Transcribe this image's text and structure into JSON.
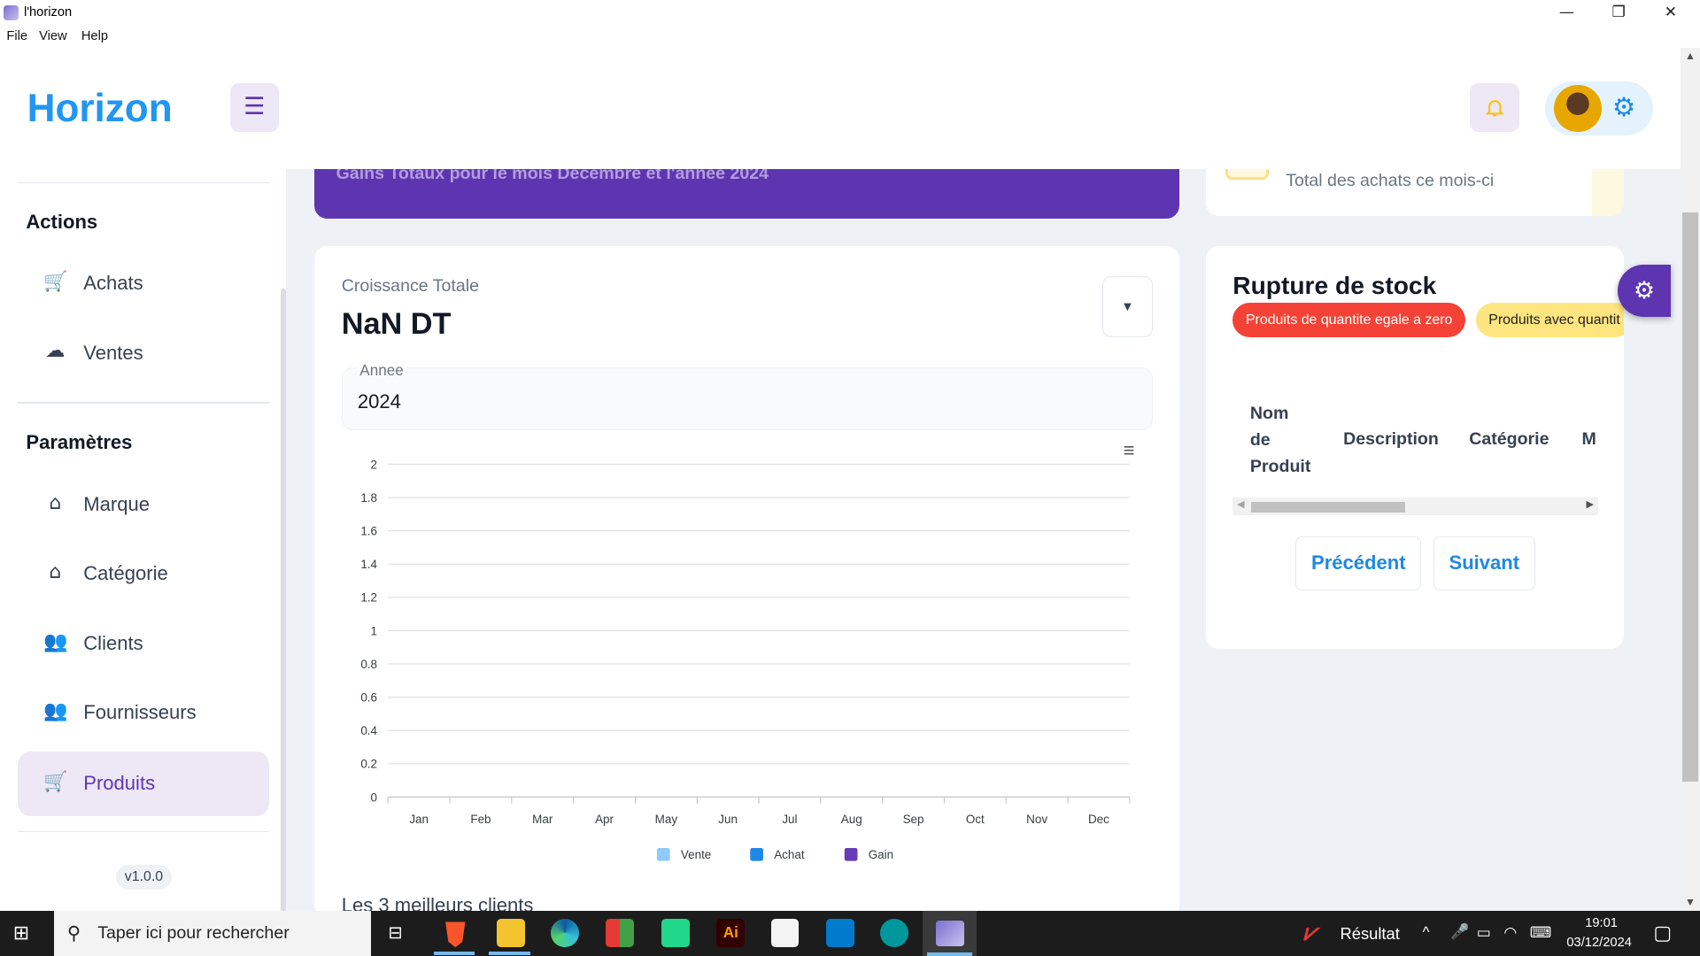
{
  "window": {
    "title": "l'horizon",
    "menu": [
      "File",
      "View",
      "Help"
    ],
    "controls": [
      "—",
      "❐",
      "✕"
    ]
  },
  "header": {
    "logo": "Horizon"
  },
  "sidebar": {
    "sections": [
      {
        "title": "Actions",
        "items": [
          {
            "label": "Achats",
            "icon": "cart-icon"
          },
          {
            "label": "Ventes",
            "icon": "sales-icon"
          }
        ]
      },
      {
        "title": "Paramètres",
        "items": [
          {
            "label": "Marque",
            "icon": "tag-icon"
          },
          {
            "label": "Catégorie",
            "icon": "tag-icon"
          },
          {
            "label": "Clients",
            "icon": "users-icon"
          },
          {
            "label": "Fournisseurs",
            "icon": "users-icon"
          },
          {
            "label": "Produits",
            "icon": "cart-icon",
            "active": true
          }
        ]
      }
    ],
    "version": "v1.0.0"
  },
  "banner": {
    "text": "Gains Totaux pour le mois Décembre et l'année 2024"
  },
  "purchases_card": {
    "text": "Total des achats ce mois-ci"
  },
  "growth": {
    "label": "Croissance Totale",
    "value": "NaN DT",
    "year_label": "Annee",
    "year_value": "2024",
    "best_clients_title": "Les 3 meilleurs clients"
  },
  "chart_data": {
    "type": "bar",
    "categories": [
      "Jan",
      "Feb",
      "Mar",
      "Apr",
      "May",
      "Jun",
      "Jul",
      "Aug",
      "Sep",
      "Oct",
      "Nov",
      "Dec"
    ],
    "series": [
      {
        "name": "Vente",
        "color": "#90caf9",
        "values": [
          0,
          0,
          0,
          0,
          0,
          0,
          0,
          0,
          0,
          0,
          0,
          0
        ]
      },
      {
        "name": "Achat",
        "color": "#1e88e5",
        "values": [
          0,
          0,
          0,
          0,
          0,
          0,
          0,
          0,
          0,
          0,
          0,
          0
        ]
      },
      {
        "name": "Gain",
        "color": "#673ab7",
        "values": [
          0,
          0,
          0,
          0,
          0,
          0,
          0,
          0,
          0,
          0,
          0,
          0
        ]
      }
    ],
    "yticks": [
      "0",
      "0.2",
      "0.4",
      "0.6",
      "0.8",
      "1",
      "1.2",
      "1.4",
      "1.6",
      "1.8",
      "2"
    ],
    "ylim": [
      0,
      2
    ],
    "grid": true,
    "legend": "bottom"
  },
  "stock": {
    "title": "Rupture de stock",
    "chip_zero": "Produits de quantite egale a zero",
    "chip_low": "Produits avec quantit",
    "columns": [
      "Nom",
      "de",
      "Produit",
      "Description",
      "Catégorie",
      "M"
    ],
    "prev": "Précédent",
    "next": "Suivant"
  },
  "taskbar": {
    "search_placeholder": "Taper ici pour rechercher",
    "result_label": "Résultat",
    "time": "19:01",
    "date": "03/12/2024"
  }
}
